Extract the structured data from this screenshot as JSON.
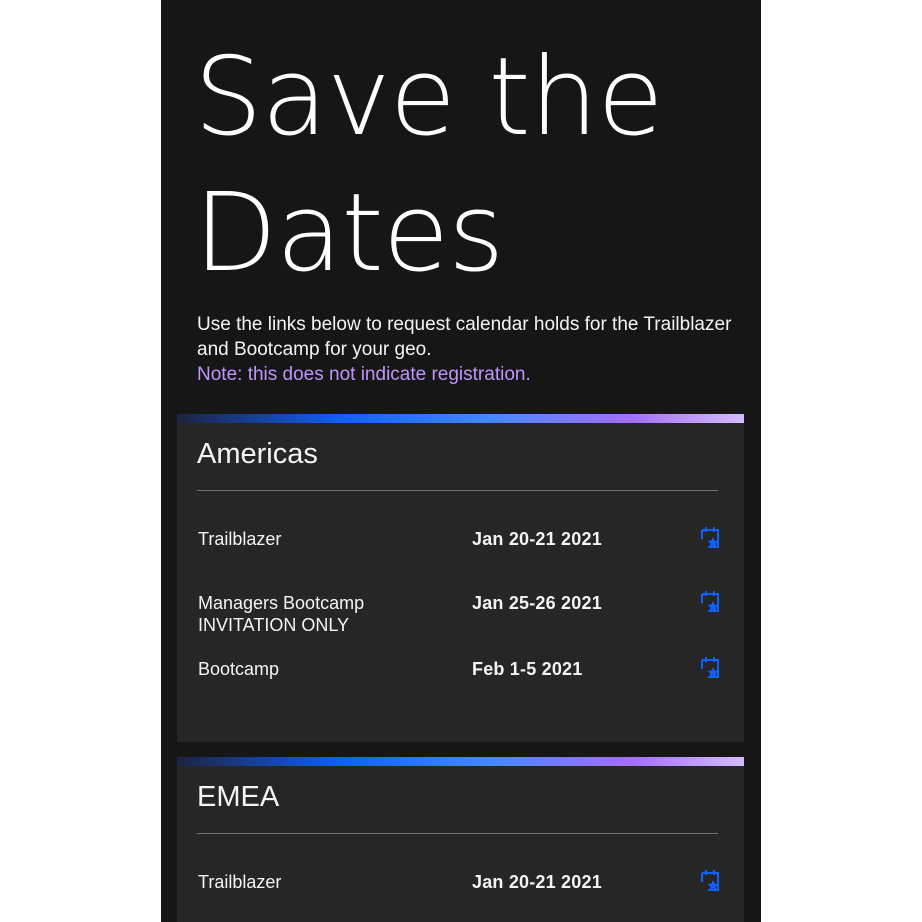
{
  "headline": {
    "line1": "Save the",
    "line2": "Dates"
  },
  "intro": {
    "text": "Use the links below to request calendar holds for the Trailblazer and Bootcamp for your geo.",
    "note": "Note: this does not indicate registration."
  },
  "colors": {
    "background": "#161616",
    "card": "#262626",
    "accent": "#0f62fe",
    "note": "#be95ff"
  },
  "regions": [
    {
      "name": "Americas",
      "events": [
        {
          "name": "Trailblazer",
          "sub": "",
          "date": "Jan 20-21 2021",
          "icon": "calendar-star-icon"
        },
        {
          "name": "Managers Bootcamp",
          "sub": "INVITATION ONLY",
          "date": "Jan 25-26 2021",
          "icon": "calendar-star-icon"
        },
        {
          "name": "Bootcamp",
          "sub": "",
          "date": "Feb 1-5 2021",
          "icon": "calendar-star-icon"
        }
      ]
    },
    {
      "name": "EMEA",
      "events": [
        {
          "name": "Trailblazer",
          "sub": "",
          "date": "Jan 20-21 2021",
          "icon": "calendar-star-icon"
        }
      ]
    }
  ]
}
